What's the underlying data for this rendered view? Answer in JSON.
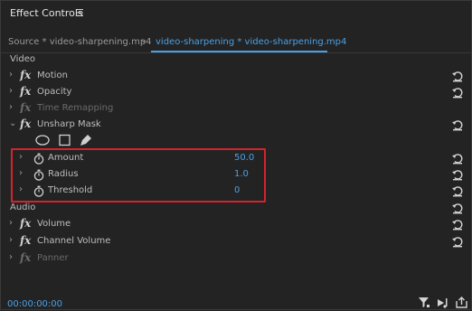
{
  "panel": {
    "title": "Effect Controls",
    "menu_glyph": "☰"
  },
  "tabs": {
    "source": "Source * video-sharpening.mp4",
    "active": "video-sharpening * video-sharpening.mp4"
  },
  "sections": {
    "video": "Video",
    "audio": "Audio"
  },
  "effects": {
    "motion": "Motion",
    "opacity": "Opacity",
    "time_remapping": "Time Remapping",
    "unsharp_mask": "Unsharp Mask",
    "volume": "Volume",
    "channel_volume": "Channel Volume",
    "panner": "Panner"
  },
  "fx_glyph": "fx",
  "params": {
    "amount": {
      "name": "Amount",
      "value": "50.0"
    },
    "radius": {
      "name": "Radius",
      "value": "1.0"
    },
    "threshold": {
      "name": "Threshold",
      "value": "0"
    }
  },
  "footer": {
    "timecode": "00:00:00:00"
  },
  "icons": [
    "menu-icon",
    "chevron-right-icon",
    "chevron-down-icon",
    "reset-icon",
    "stopwatch-icon",
    "ellipse-mask-icon",
    "rectangle-mask-icon",
    "pen-mask-icon",
    "filter-icon",
    "play-audio-icon",
    "export-icon"
  ],
  "colors": {
    "accent": "#4aa0e6",
    "highlight": "#d3232b",
    "background": "#232323"
  }
}
